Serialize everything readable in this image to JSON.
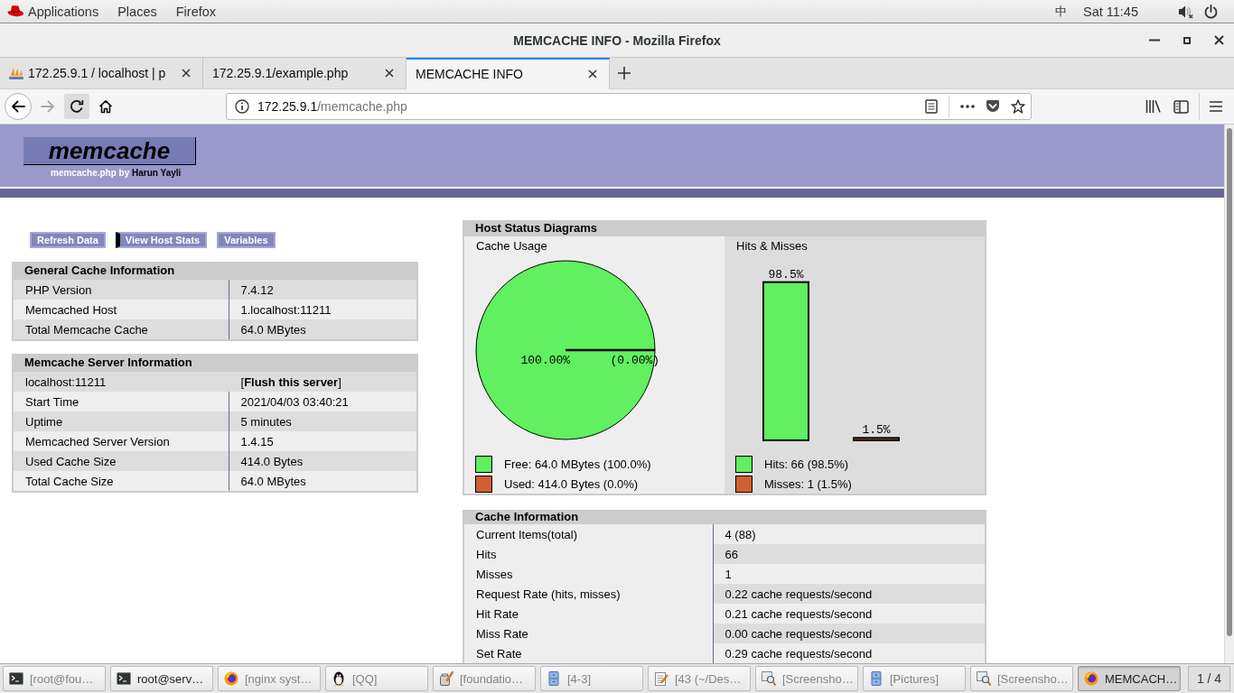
{
  "top_bar": {
    "menus": [
      "Applications",
      "Places",
      "Firefox"
    ],
    "input_method": "中",
    "clock": "Sat 11:45"
  },
  "window": {
    "title": "MEMCACHE INFO - Mozilla Firefox"
  },
  "tabs": [
    {
      "label": "172.25.9.1 / localhost | p",
      "selected": false,
      "favicon": true
    },
    {
      "label": "172.25.9.1/example.php",
      "selected": false,
      "favicon": false
    },
    {
      "label": "MEMCACHE INFO",
      "selected": true,
      "favicon": false
    }
  ],
  "nav_buttons": [
    {
      "kind": "back",
      "disabled": false,
      "hovered": false
    },
    {
      "kind": "forward",
      "disabled": true,
      "hovered": false
    },
    {
      "kind": "reload",
      "disabled": false,
      "hovered": true
    },
    {
      "kind": "home",
      "disabled": false,
      "hovered": false
    }
  ],
  "address_bar": {
    "host": "172.25.9.1",
    "path": "/memcache.php"
  },
  "page": {
    "logo": "memcache",
    "credit": {
      "text": "memcache.php by",
      "author": "Harun Yayli"
    },
    "menu": [
      {
        "label": "Refresh Data",
        "selected": false
      },
      {
        "label": "View Host Stats",
        "selected": true
      },
      {
        "label": "Variables",
        "selected": false
      }
    ],
    "general_info": {
      "title": "General Cache Information",
      "rows": [
        {
          "label": "PHP Version",
          "value": "7.4.12"
        },
        {
          "label": "Memcached Host",
          "value": "1.localhost:11211"
        },
        {
          "label": "Total Memcache Cache",
          "value": "64.0 MBytes"
        }
      ]
    },
    "server_info": {
      "title": "Memcache Server Information",
      "server": "localhost:11211",
      "flush_link": "[**Flush this server**]",
      "rows": [
        {
          "label": "Start Time",
          "value": "2021/04/03 03:40:21"
        },
        {
          "label": "Uptime",
          "value": "5 minutes"
        },
        {
          "label": "Memcached Server Version",
          "value": "1.4.15"
        },
        {
          "label": "Used Cache Size",
          "value": "414.0 Bytes"
        },
        {
          "label": "Total Cache Size",
          "value": "64.0 MBytes"
        }
      ]
    },
    "host_status": {
      "title": "Host Status Diagrams",
      "panes": [
        {
          "title": "Cache Usage",
          "chart_data": {
            "type": "pie",
            "values": [
              100,
              0
            ],
            "colors": [
              "#60f060",
              "#d06030"
            ],
            "value_labels": [
              "100.00%",
              "(0.00%)"
            ]
          },
          "legend_items": [
            {
              "label": "Free: 64.0 MBytes (100.0%)",
              "color": "#60f060"
            },
            {
              "label": "Used: 414.0 Bytes (0.0%)",
              "color": "#d06030"
            }
          ]
        },
        {
          "title": "Hits & Misses",
          "chart_data": {
            "type": "bar",
            "categories": [
              null,
              null
            ],
            "values": [
              98.5,
              1.5
            ],
            "colors": [
              "#60f060",
              "#d06030"
            ],
            "value_labels": [
              "98.5%",
              "1.5%"
            ]
          },
          "legend_items": [
            {
              "label": "Hits: 66 (98.5%)",
              "color": "#60f060"
            },
            {
              "label": "Misses: 1 (1.5%)",
              "color": "#d06030"
            }
          ]
        }
      ]
    },
    "cache_info": {
      "title": "Cache Information",
      "rows": [
        {
          "label": "Current Items(total)",
          "value": "4 (88)"
        },
        {
          "label": "Hits",
          "value": "66"
        },
        {
          "label": "Misses",
          "value": "1"
        },
        {
          "label": "Request Rate (hits, misses)",
          "value": "0.22 cache requests/second"
        },
        {
          "label": "Hit Rate",
          "value": "0.21 cache requests/second"
        },
        {
          "label": "Miss Rate",
          "value": "0.00 cache requests/second"
        },
        {
          "label": "Set Rate",
          "value": "0.29 cache requests/second"
        }
      ]
    }
  },
  "taskbar": {
    "items": [
      {
        "label": "[root@fou…",
        "kind": "terminal",
        "minimized": true,
        "selected": false
      },
      {
        "label": "root@serv…",
        "kind": "terminal",
        "minimized": false,
        "selected": false
      },
      {
        "label": "[nginx syst…",
        "kind": "browser",
        "minimized": true,
        "selected": false
      },
      {
        "label": "[QQ]",
        "kind": "chat",
        "minimized": true,
        "selected": false
      },
      {
        "label": "[foundatio…",
        "kind": "paint",
        "minimized": true,
        "selected": false
      },
      {
        "label": "[4-3]",
        "kind": "files",
        "minimized": true,
        "selected": false
      },
      {
        "label": "[43 (~/Des…",
        "kind": "editor",
        "minimized": true,
        "selected": false
      },
      {
        "label": "[Screensho…",
        "kind": "screenshot",
        "minimized": true,
        "selected": false
      },
      {
        "label": "[Pictures]",
        "kind": "files",
        "minimized": true,
        "selected": false
      },
      {
        "label": "[Screensho…",
        "kind": "screenshot",
        "minimized": true,
        "selected": false
      },
      {
        "label": "MEMCACH…",
        "kind": "browser",
        "minimized": false,
        "selected": true
      }
    ],
    "workspace": "1 / 4"
  }
}
